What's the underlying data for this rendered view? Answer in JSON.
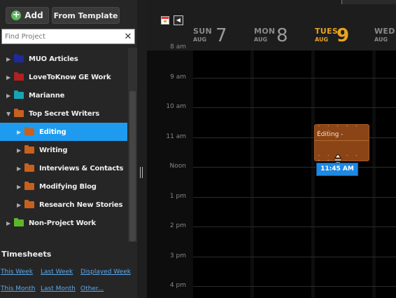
{
  "toolbar": {
    "add_label": "Add",
    "template_label": "From Template"
  },
  "search": {
    "placeholder": "Find Project",
    "clear_icon": "close-icon"
  },
  "tree": [
    {
      "label": "MUO Articles",
      "color": "#1f2a9a",
      "expanded": false,
      "level": 0,
      "selected": false
    },
    {
      "label": "LoveToKnow GE Work",
      "color": "#b02121",
      "expanded": false,
      "level": 0,
      "selected": false
    },
    {
      "label": "Marianne",
      "color": "#18a5b3",
      "expanded": false,
      "level": 0,
      "selected": false
    },
    {
      "label": "Top Secret Writers",
      "color": "#c8601e",
      "expanded": true,
      "level": 0,
      "selected": false
    },
    {
      "label": "Editing",
      "color": "#c8601e",
      "expanded": false,
      "level": 1,
      "selected": true
    },
    {
      "label": "Writing",
      "color": "#c8601e",
      "expanded": false,
      "level": 1,
      "selected": false
    },
    {
      "label": "Interviews & Contacts",
      "color": "#c8601e",
      "expanded": false,
      "level": 1,
      "selected": false
    },
    {
      "label": "Modifying Blog",
      "color": "#c8601e",
      "expanded": false,
      "level": 1,
      "selected": false
    },
    {
      "label": "Research New Stories",
      "color": "#c8601e",
      "expanded": false,
      "level": 1,
      "selected": false
    },
    {
      "label": "Non-Project Work",
      "color": "#5cb82a",
      "expanded": false,
      "level": 0,
      "selected": false
    }
  ],
  "timesheets": {
    "title": "Timesheets",
    "links": [
      "This Week",
      "Last Week",
      "Displayed Week",
      "This Month",
      "Last Month",
      "Other..."
    ]
  },
  "calendar": {
    "days": [
      {
        "name": "SUN",
        "month": "AUG",
        "num": "7",
        "today": false
      },
      {
        "name": "MON",
        "month": "AUG",
        "num": "8",
        "today": false
      },
      {
        "name": "TUES",
        "month": "AUG",
        "num": "9",
        "today": true
      },
      {
        "name": "WED",
        "month": "AUG",
        "num": "",
        "today": false
      }
    ],
    "hours": [
      "8 am",
      "9 am",
      "10 am",
      "11 am",
      "Noon",
      "1 pm",
      "2 pm",
      "3 pm",
      "4 pm"
    ],
    "today_color": "#e8a322",
    "event": {
      "title": "Editing -",
      "color": "#8a4416"
    },
    "tooltip": "11:45 AM"
  }
}
